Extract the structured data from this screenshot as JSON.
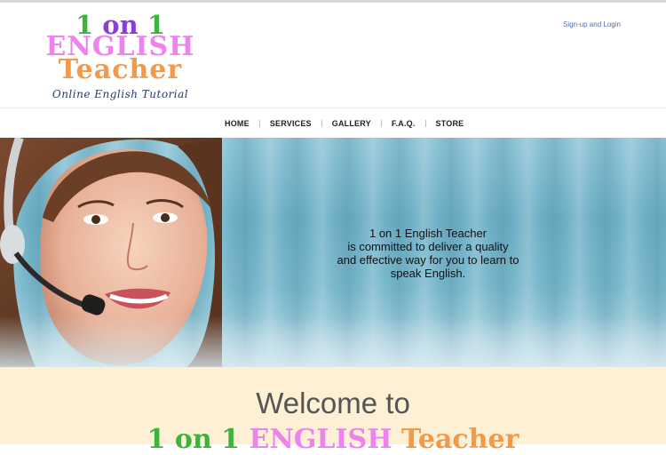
{
  "header": {
    "logo": {
      "line1": {
        "one": "1",
        "on": "on",
        "one2": "1"
      },
      "line2": "ENGLISH",
      "line3": "Teacher",
      "tagline": "Online English Tutorial"
    },
    "signup_link": "Sign-up and Login"
  },
  "nav": {
    "items": [
      {
        "label": "HOME"
      },
      {
        "label": "SERVICES"
      },
      {
        "label": "GALLERY"
      },
      {
        "label": "F.A.Q."
      },
      {
        "label": "STORE"
      }
    ]
  },
  "hero": {
    "line1": "1 on 1 English Teacher",
    "line2": "is committed to deliver a quality",
    "line3": "and effective way for you to learn to",
    "line4": "speak English."
  },
  "welcome": {
    "title": "Welcome to",
    "brand_part1": "1 on 1",
    "brand_part2": "ENGLISH",
    "brand_part3": "Teacher"
  },
  "colors": {
    "logo_green": "#3cb43c",
    "logo_purple": "#8a3fd1",
    "logo_pink": "#ee82ee",
    "logo_orange": "#f2994a",
    "welcome_bg": "#fdf0d5",
    "link_blue": "#4f6fbf"
  }
}
